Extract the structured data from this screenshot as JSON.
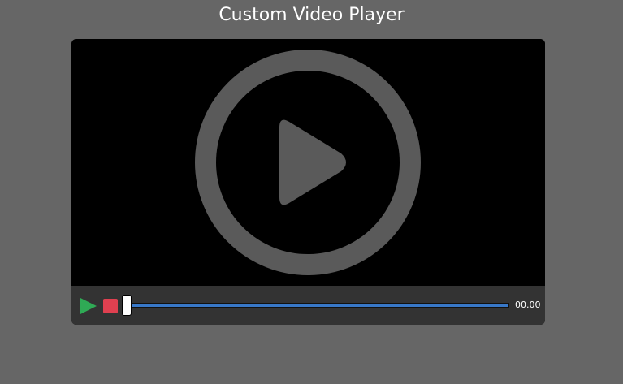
{
  "page": {
    "title": "Custom Video Player"
  },
  "player": {
    "big_play_icon": "play-circle-icon",
    "controls": {
      "play_icon": "play-icon",
      "stop_icon": "stop-icon",
      "progress": 0,
      "timestamp": "00.00"
    }
  },
  "colors": {
    "page_background": "#666666",
    "screen_background": "#000000",
    "controls_background": "#333333",
    "big_play_icon": "#5a5a5a",
    "play_button": "#2faa55",
    "stop_button": "#e04050",
    "progress_track": "#3878c8",
    "progress_thumb": "#ffffff"
  }
}
